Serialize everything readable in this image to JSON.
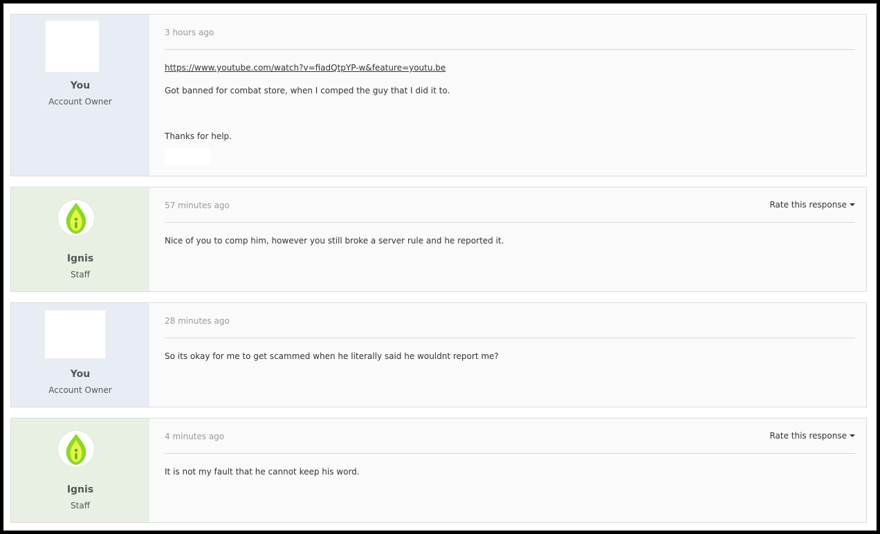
{
  "posts": [
    {
      "author": "You",
      "role": "Account Owner",
      "time": "3 hours ago",
      "link": "https://www.youtube.com/watch?v=fiadQtpYP-w&feature=youtu.be",
      "lines": [
        "Got banned for combat store, when I comped the guy that I did it to.",
        "Thanks for help."
      ]
    },
    {
      "author": "Ignis",
      "role": "Staff",
      "time": "57 minutes ago",
      "rate_label": "Rate this response",
      "lines": [
        "Nice of you to comp him, however you still broke a server rule and he reported it."
      ]
    },
    {
      "author": "You",
      "role": "Account Owner",
      "time": "28 minutes ago",
      "lines": [
        "So its okay for me to get scammed when he literally said he wouldnt report me?"
      ]
    },
    {
      "author": "Ignis",
      "role": "Staff",
      "time": "4 minutes ago",
      "rate_label": "Rate this response",
      "lines": [
        "It is not my fault that he cannot keep his word."
      ]
    }
  ],
  "colors": {
    "customer_panel": "#e8edf5",
    "staff_panel": "#e7f0e2",
    "flame_outer": "#8bd82a",
    "flame_inner": "#e6f545"
  },
  "icons": {
    "staff_avatar": "flame-logo-icon"
  }
}
